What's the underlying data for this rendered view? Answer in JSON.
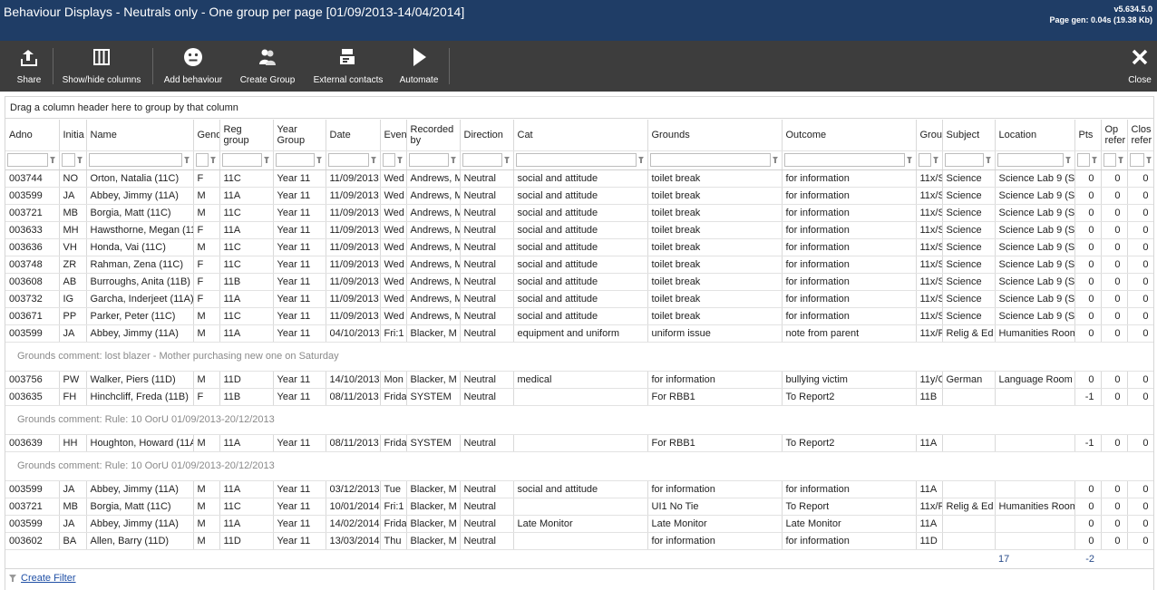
{
  "window": {
    "title": "Behaviour Displays - Neutrals only - One group per page [01/09/2013-14/04/2014]",
    "version": "v5.634.5.0",
    "page_gen": "Page gen: 0.04s (19.38 Kb)"
  },
  "toolbar": {
    "share": "Share",
    "show_hide": "Show/hide columns",
    "add_behaviour": "Add behaviour",
    "create_group": "Create Group",
    "external_contacts": "External contacts",
    "automate": "Automate",
    "close": "Close"
  },
  "grid": {
    "group_hint": "Drag a column header here to group by that column",
    "columns": [
      {
        "key": "adno",
        "label": "Adno"
      },
      {
        "key": "init",
        "label": "Initia"
      },
      {
        "key": "name",
        "label": "Name"
      },
      {
        "key": "gender",
        "label": "Gend"
      },
      {
        "key": "reg",
        "label": "Reg group"
      },
      {
        "key": "year",
        "label": "Year Group"
      },
      {
        "key": "date",
        "label": "Date"
      },
      {
        "key": "event",
        "label": "Even"
      },
      {
        "key": "recorded",
        "label": "Recorded by"
      },
      {
        "key": "direction",
        "label": "Direction"
      },
      {
        "key": "cat",
        "label": "Cat"
      },
      {
        "key": "grounds",
        "label": "Grounds"
      },
      {
        "key": "outcome",
        "label": "Outcome"
      },
      {
        "key": "group",
        "label": "Grou"
      },
      {
        "key": "subject",
        "label": "Subject"
      },
      {
        "key": "location",
        "label": "Location"
      },
      {
        "key": "pts",
        "label": "Pts"
      },
      {
        "key": "open",
        "label": "Op refer"
      },
      {
        "key": "closed",
        "label": "Clos refer"
      }
    ],
    "rows": [
      {
        "kind": "data",
        "cells": [
          "003744",
          "NO",
          "Orton, Natalia (11C)",
          "F",
          "11C",
          "Year 11",
          "11/09/2013",
          "Wed",
          "Andrews, M",
          "Neutral",
          "social and attitude",
          "toilet break",
          "for information",
          "11x/Sc",
          "Science",
          "Science Lab 9 (S9)",
          "0",
          "0",
          "0"
        ]
      },
      {
        "kind": "data",
        "cells": [
          "003599",
          "JA",
          "Abbey, Jimmy (11A)",
          "M",
          "11A",
          "Year 11",
          "11/09/2013",
          "Wed",
          "Andrews, M",
          "Neutral",
          "social and attitude",
          "toilet break",
          "for information",
          "11x/Sc",
          "Science",
          "Science Lab 9 (S9)",
          "0",
          "0",
          "0"
        ]
      },
      {
        "kind": "data",
        "cells": [
          "003721",
          "MB",
          "Borgia, Matt (11C)",
          "M",
          "11C",
          "Year 11",
          "11/09/2013",
          "Wed",
          "Andrews, M",
          "Neutral",
          "social and attitude",
          "toilet break",
          "for information",
          "11x/Sc",
          "Science",
          "Science Lab 9 (S9)",
          "0",
          "0",
          "0"
        ]
      },
      {
        "kind": "data",
        "cells": [
          "003633",
          "MH",
          "Hawsthorne, Megan (11A)",
          "F",
          "11A",
          "Year 11",
          "11/09/2013",
          "Wed",
          "Andrews, M",
          "Neutral",
          "social and attitude",
          "toilet break",
          "for information",
          "11x/Sc",
          "Science",
          "Science Lab 9 (S9)",
          "0",
          "0",
          "0"
        ]
      },
      {
        "kind": "data",
        "cells": [
          "003636",
          "VH",
          "Honda, Vai (11C)",
          "M",
          "11C",
          "Year 11",
          "11/09/2013",
          "Wed",
          "Andrews, M",
          "Neutral",
          "social and attitude",
          "toilet break",
          "for information",
          "11x/Sc",
          "Science",
          "Science Lab 9 (S9)",
          "0",
          "0",
          "0"
        ]
      },
      {
        "kind": "data",
        "cells": [
          "003748",
          "ZR",
          "Rahman, Zena (11C)",
          "F",
          "11C",
          "Year 11",
          "11/09/2013",
          "Wed",
          "Andrews, M",
          "Neutral",
          "social and attitude",
          "toilet break",
          "for information",
          "11x/Sc",
          "Science",
          "Science Lab 9 (S9)",
          "0",
          "0",
          "0"
        ]
      },
      {
        "kind": "data",
        "cells": [
          "003608",
          "AB",
          "Burroughs, Anita (11B)",
          "F",
          "11B",
          "Year 11",
          "11/09/2013",
          "Wed",
          "Andrews, M",
          "Neutral",
          "social and attitude",
          "toilet break",
          "for information",
          "11x/Sc",
          "Science",
          "Science Lab 9 (S9)",
          "0",
          "0",
          "0"
        ]
      },
      {
        "kind": "data",
        "cells": [
          "003732",
          "IG",
          "Garcha, Inderjeet (11A)",
          "F",
          "11A",
          "Year 11",
          "11/09/2013",
          "Wed",
          "Andrews, M",
          "Neutral",
          "social and attitude",
          "toilet break",
          "for information",
          "11x/Sc",
          "Science",
          "Science Lab 9 (S9)",
          "0",
          "0",
          "0"
        ]
      },
      {
        "kind": "data",
        "cells": [
          "003671",
          "PP",
          "Parker, Peter (11C)",
          "M",
          "11C",
          "Year 11",
          "11/09/2013",
          "Wed",
          "Andrews, M",
          "Neutral",
          "social and attitude",
          "toilet break",
          "for information",
          "11x/Sc",
          "Science",
          "Science Lab 9 (S9)",
          "0",
          "0",
          "0"
        ]
      },
      {
        "kind": "data",
        "cells": [
          "003599",
          "JA",
          "Abbey, Jimmy (11A)",
          "M",
          "11A",
          "Year 11",
          "04/10/2013",
          "Fri:1",
          "Blacker, M",
          "Neutral",
          "equipment and uniform",
          "uniform issue",
          "note from parent",
          "11x/Re",
          "Relig & Ed",
          "Humanities Room",
          "0",
          "0",
          "0"
        ]
      },
      {
        "kind": "comment",
        "text": "Grounds comment: lost blazer - Mother purchasing new one on Saturday"
      },
      {
        "kind": "data",
        "cells": [
          "003756",
          "PW",
          "Walker, Piers (11D)",
          "M",
          "11D",
          "Year 11",
          "14/10/2013",
          "Mon",
          "Blacker, M",
          "Neutral",
          "medical",
          "for information",
          "bullying victim",
          "11y/Ge",
          "German",
          "Language Room",
          "0",
          "0",
          "0"
        ]
      },
      {
        "kind": "data",
        "cells": [
          "003635",
          "FH",
          "Hinchcliff, Freda (11B)",
          "F",
          "11B",
          "Year 11",
          "08/11/2013",
          "Friday",
          "SYSTEM",
          "Neutral",
          "",
          "For RBB1",
          "To Report2",
          "11B",
          "",
          "",
          "-1",
          "0",
          "0"
        ]
      },
      {
        "kind": "comment",
        "text": "Grounds comment: Rule: 10 OorU 01/09/2013-20/12/2013"
      },
      {
        "kind": "data",
        "cells": [
          "003639",
          "HH",
          "Houghton, Howard (11A)",
          "M",
          "11A",
          "Year 11",
          "08/11/2013",
          "Friday",
          "SYSTEM",
          "Neutral",
          "",
          "For RBB1",
          "To Report2",
          "11A",
          "",
          "",
          "-1",
          "0",
          "0"
        ]
      },
      {
        "kind": "comment",
        "text": "Grounds comment: Rule: 10 OorU 01/09/2013-20/12/2013"
      },
      {
        "kind": "data",
        "cells": [
          "003599",
          "JA",
          "Abbey, Jimmy (11A)",
          "M",
          "11A",
          "Year 11",
          "03/12/2013",
          "Tue",
          "Blacker, M",
          "Neutral",
          "social and attitude",
          "for information",
          "for information",
          "11A",
          "",
          "",
          "0",
          "0",
          "0"
        ]
      },
      {
        "kind": "data",
        "cells": [
          "003721",
          "MB",
          "Borgia, Matt (11C)",
          "M",
          "11C",
          "Year 11",
          "10/01/2014",
          "Fri:1",
          "Blacker, M",
          "Neutral",
          "",
          "UI1 No Tie",
          "To Report",
          "11x/Re",
          "Relig & Ed",
          "Humanities Room",
          "0",
          "0",
          "0"
        ]
      },
      {
        "kind": "data",
        "cells": [
          "003599",
          "JA",
          "Abbey, Jimmy (11A)",
          "M",
          "11A",
          "Year 11",
          "14/02/2014",
          "Friday",
          "Blacker, M",
          "Neutral",
          "Late Monitor",
          "Late Monitor",
          "Late Monitor",
          "11A",
          "",
          "",
          "0",
          "0",
          "0"
        ]
      },
      {
        "kind": "data",
        "cells": [
          "003602",
          "BA",
          "Allen, Barry (11D)",
          "M",
          "11D",
          "Year 11",
          "13/03/2014",
          "Thu",
          "Blacker, M",
          "Neutral",
          "",
          "for information",
          "for information",
          "11D",
          "",
          "",
          "0",
          "0",
          "0"
        ]
      }
    ],
    "totals": {
      "count": "17",
      "pts": "-2"
    }
  },
  "footer": {
    "create_filter": "Create Filter"
  }
}
